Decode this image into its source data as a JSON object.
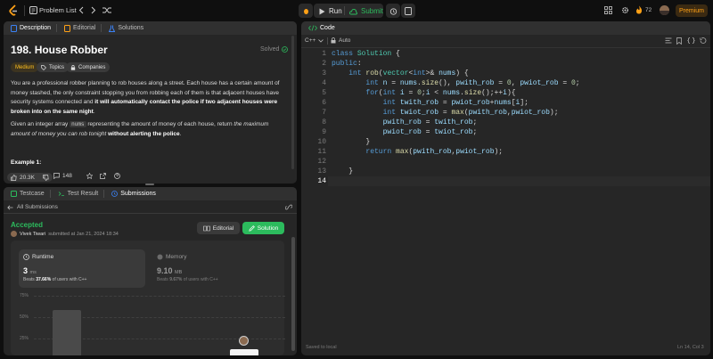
{
  "topbar": {
    "problem_list": "Problem List",
    "run": "Run",
    "submit": "Submit",
    "streak": "72",
    "premium": "Premium"
  },
  "desc_panel": {
    "tabs": [
      "Description",
      "Editorial",
      "Solutions"
    ],
    "title": "198. House Robber",
    "solved": "Solved",
    "difficulty": "Medium",
    "topics": "Topics",
    "companies": "Companies",
    "para1_a": "You are a professional robber planning to rob houses along a street. Each house has a certain amount of money stashed, the only constraint stopping you from robbing each of them is that adjacent houses have security systems connected and ",
    "para1_b": "it will automatically contact the police if two adjacent houses were broken into on the same night",
    "para1_c": ".",
    "para2_a": "Given an integer array ",
    "para2_code": "nums",
    "para2_b": " representing the amount of money of each house, return ",
    "para2_c": "the maximum amount of money you can rob tonight ",
    "para2_d": "without alerting the police",
    "para2_e": ".",
    "example": "Example 1:",
    "likes": "20.3K",
    "comments": "148"
  },
  "result_panel": {
    "tabs": [
      "Testcase",
      "Test Result",
      "Submissions"
    ],
    "back": "All Submissions",
    "status": "Accepted",
    "user": "Vivek Tiwari",
    "submitted": "submitted at Jan 21, 2024 18:34",
    "editorial_btn": "Editorial",
    "solution_btn": "Solution",
    "runtime_label": "Runtime",
    "runtime_value": "3",
    "runtime_unit": "ms",
    "runtime_beats_a": "Beats ",
    "runtime_beats_b": "37.66%",
    "runtime_beats_c": " of users with C++",
    "memory_label": "Memory",
    "memory_value": "9.10",
    "memory_unit": "MB",
    "memory_beats_a": "Beats ",
    "memory_beats_b": "9.67%",
    "memory_beats_c": " of users with C++",
    "y_ticks": [
      "75%",
      "50%",
      "25%"
    ]
  },
  "code_panel": {
    "tab": "Code",
    "lang": "C++",
    "auto": "Auto",
    "saved": "Saved to local",
    "cursor": "Ln 14, Col 3",
    "line_numbers": [
      "1",
      "2",
      "3",
      "4",
      "5",
      "6",
      "7",
      "8",
      "9",
      "10",
      "11",
      "12",
      "13",
      "14"
    ]
  },
  "colors": {
    "accent": "#ffa116",
    "green": "#2cbb5d",
    "blue": "#3b82f6"
  }
}
